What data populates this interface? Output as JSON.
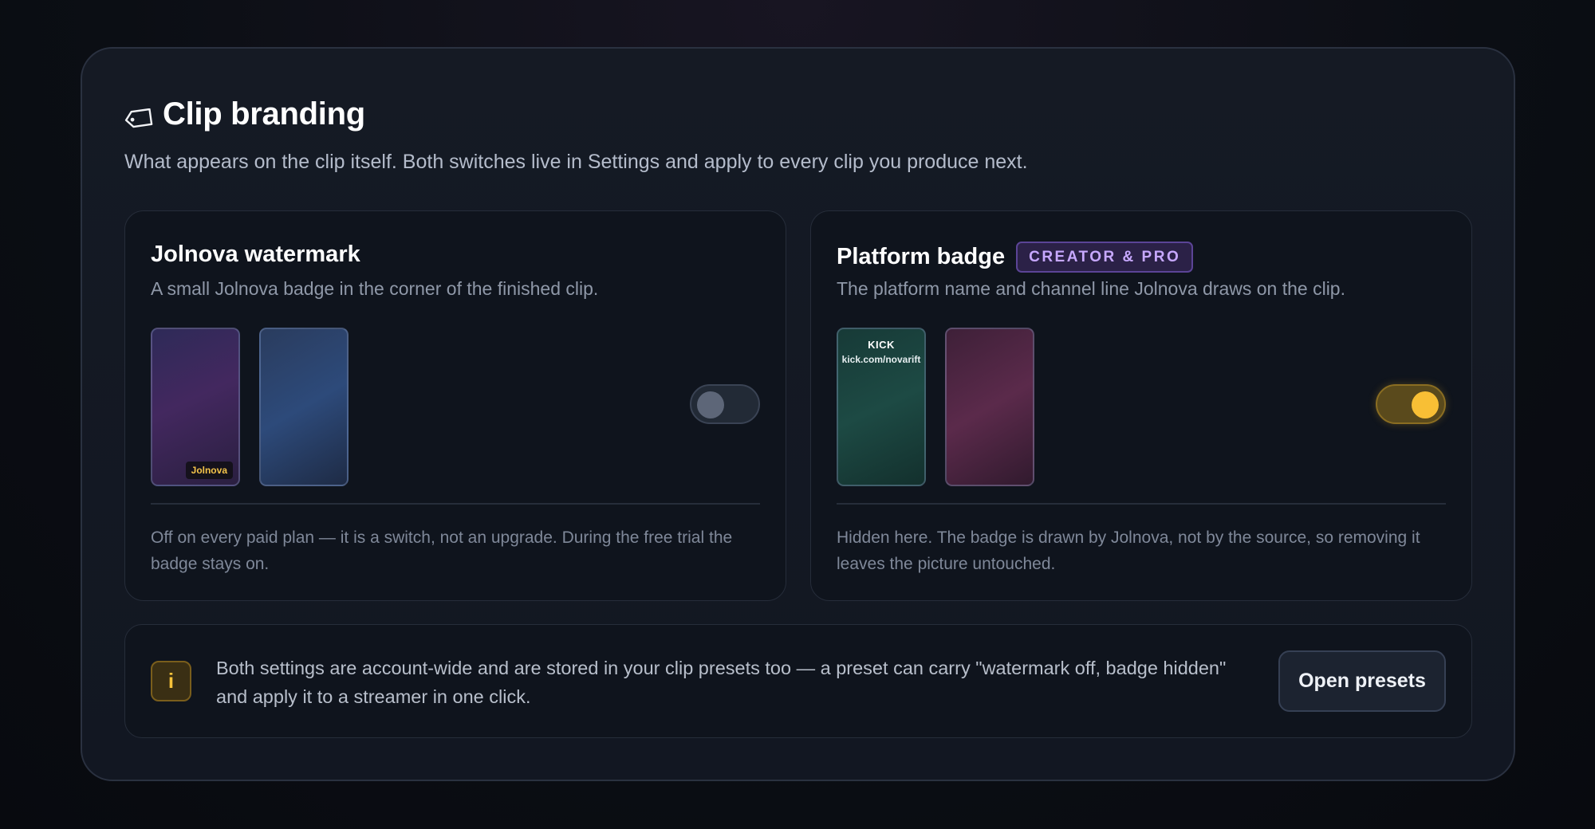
{
  "header": {
    "icon": "tag-icon",
    "title": "Clip branding",
    "subtitle": "What appears on the clip itself. Both switches live in Settings and apply to every clip you produce next."
  },
  "watermark_card": {
    "title": "Jolnova watermark",
    "description": "A small Jolnova badge in the corner of the finished clip.",
    "preview_badge": "Jolnova",
    "toggle_on": false,
    "note": "Off on every paid plan — it is a switch, not an upgrade. During the free trial the badge stays on."
  },
  "badge_card": {
    "title": "Platform badge",
    "plan_badge": "CREATOR & PRO",
    "description": "The platform name and channel line Jolnova draws on the clip.",
    "preview_platform": "KICK",
    "preview_channel": "kick.com/novarift",
    "toggle_on": true,
    "note": "Hidden here. The badge is drawn by Jolnova, not by the source, so removing it leaves the picture untouched."
  },
  "info_bar": {
    "icon": "info-icon",
    "icon_glyph": "i",
    "text": "Both settings are account-wide and are stored in your clip presets too — a preset can carry \"watermark off, badge hidden\" and apply it to a streamer in one click.",
    "button_label": "Open presets"
  },
  "colors": {
    "accent": "#f8bf35",
    "plan_badge": "#c7a8ff"
  }
}
